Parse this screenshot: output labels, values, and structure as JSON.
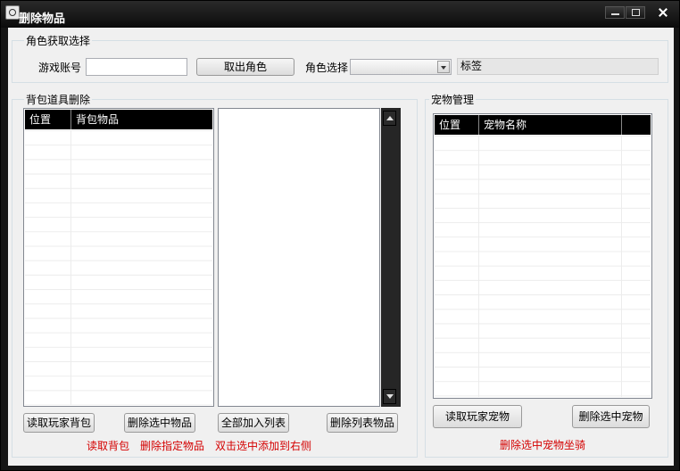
{
  "window": {
    "title": "删除物品"
  },
  "role_group": {
    "title": "角色获取选择",
    "account_label": "游戏账号",
    "account_value": "",
    "fetch_button": "取出角色",
    "role_select_label": "角色选择",
    "role_select_value": "",
    "tag_label": "标签"
  },
  "backpack_group": {
    "title": "背包道具删除",
    "columns": [
      "位置",
      "背包物品"
    ],
    "rows": [],
    "read_button": "读取玩家背包",
    "delete_selected_button": "删除选中物品",
    "add_all_button": "全部加入列表",
    "delete_list_button": "删除列表物品",
    "hint_read": "读取背包",
    "hint_delete": "删除指定物品",
    "hint_dblclick": "双击选中添加到右侧"
  },
  "pet_group": {
    "title": "宠物管理",
    "columns": [
      "位置",
      "宠物名称",
      ""
    ],
    "rows": [],
    "read_button": "读取玩家宠物",
    "delete_button": "删除选中宠物",
    "hint": "删除选中宠物坐骑"
  },
  "colors": {
    "hint_red": "#d40000",
    "header_black": "#000000"
  }
}
